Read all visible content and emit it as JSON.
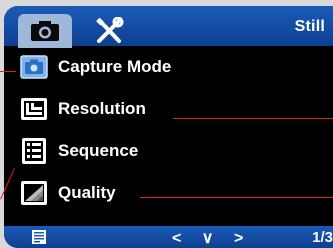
{
  "header": {
    "tabs": [
      {
        "name": "camera",
        "icon": "camera-icon",
        "active": true
      },
      {
        "name": "settings",
        "icon": "wrench-screwdriver-icon",
        "active": false
      }
    ],
    "mode_label": "Still"
  },
  "menu": {
    "items": [
      {
        "label": "Capture Mode",
        "icon": "capture-mode-icon",
        "selected": true
      },
      {
        "label": "Resolution",
        "icon": "resolution-icon",
        "selected": false
      },
      {
        "label": "Sequence",
        "icon": "sequence-icon",
        "selected": false
      },
      {
        "label": "Quality",
        "icon": "quality-icon",
        "selected": false
      }
    ]
  },
  "footer": {
    "left_icon": "document-icon",
    "nav": "< ∨ >",
    "page": "1/3"
  },
  "colors": {
    "bar_blue": "#1a5bb8",
    "active_tab": "#9fb7d8",
    "callout_red": "#e02020"
  }
}
